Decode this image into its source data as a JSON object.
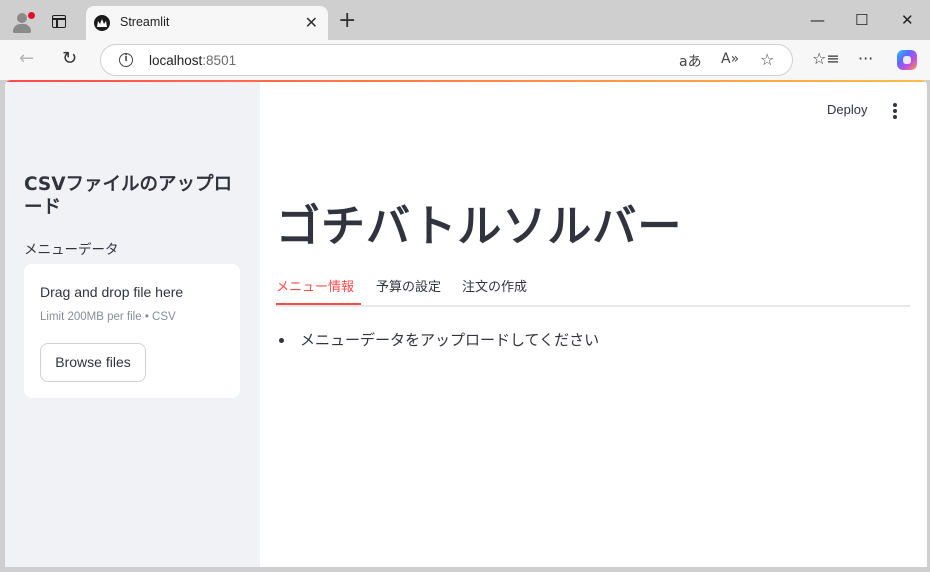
{
  "browser": {
    "tab_title": "Streamlit",
    "url_host": "localhost",
    "url_port": ":8501"
  },
  "sidebar": {
    "title": "CSVファイルのアップロード",
    "uploader_label": "メニューデータ",
    "dropzone_main": "Drag and drop file here",
    "dropzone_sub": "Limit 200MB per file • CSV",
    "browse_label": "Browse files"
  },
  "header": {
    "deploy_label": "Deploy"
  },
  "main": {
    "title": "ゴチバトルソルバー",
    "tabs": [
      {
        "label": "メニュー情報",
        "active": true
      },
      {
        "label": "予算の設定",
        "active": false
      },
      {
        "label": "注文の作成",
        "active": false
      }
    ],
    "message": "メニューデータをアップロードしてください"
  },
  "colors": {
    "accent": "#ff4b4b",
    "sidebar_bg": "#f0f2f6",
    "text": "#31333f"
  }
}
